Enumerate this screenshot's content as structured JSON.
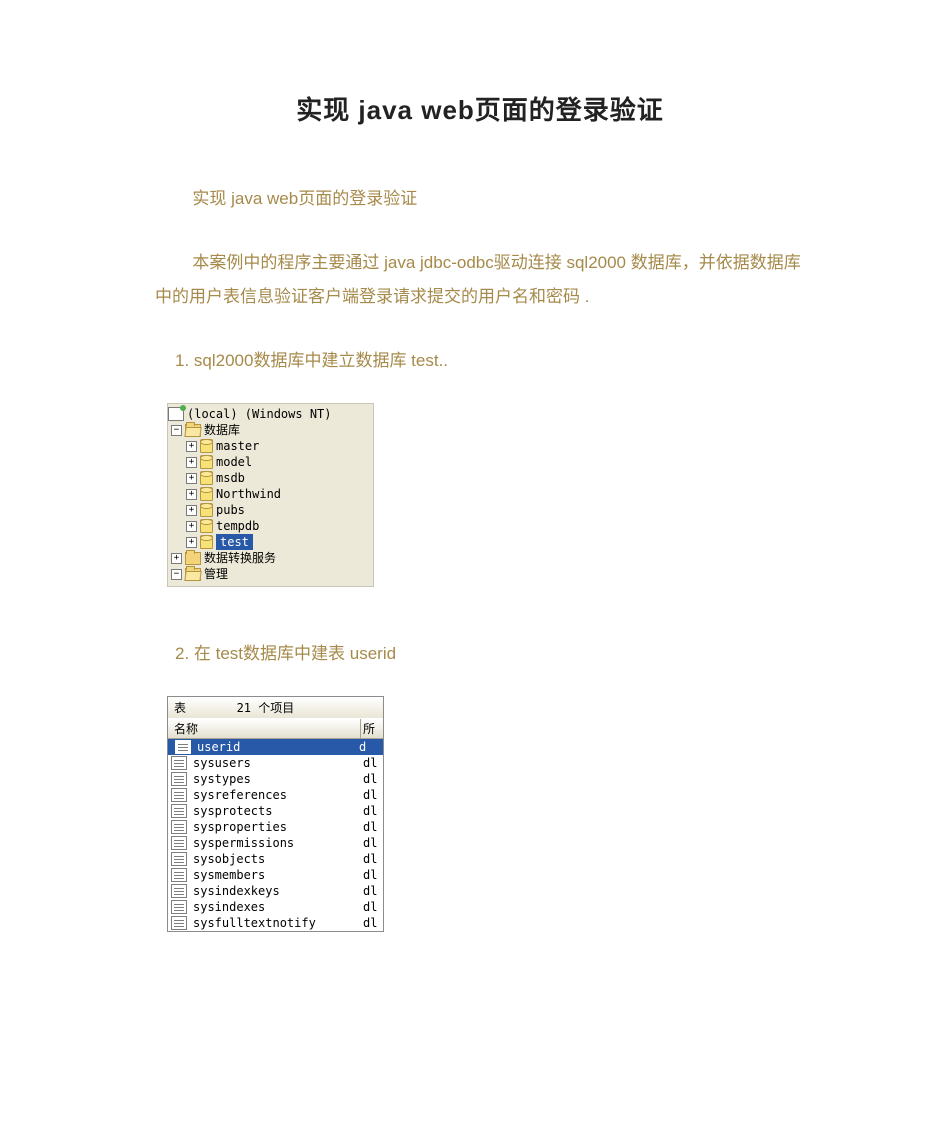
{
  "title": "实现 java  web页面的登录验证",
  "subtitle": "实现 java web页面的登录验证",
  "intro": "本案例中的程序主要通过 java jdbc-odbc驱动连接 sql2000 数据库，并依据数据库中的用户表信息验证客户端登录请求提交的用户名和密码 .",
  "step1": "1. sql2000数据库中建立数据库 test..",
  "step2": "2. 在 test数据库中建表 userid",
  "tree": {
    "server": "(local) (Windows NT)",
    "root_folder": "数据库",
    "dbs": [
      "master",
      "model",
      "msdb",
      "Northwind",
      "pubs",
      "tempdb",
      "test"
    ],
    "selected": "test",
    "other_nodes": [
      "数据转换服务",
      "管理"
    ]
  },
  "table_list": {
    "header": "表       21 个项目",
    "col1": "名称",
    "col2": "所",
    "selected": "userid",
    "items": [
      {
        "name": "userid",
        "c2": "d"
      },
      {
        "name": "sysusers",
        "c2": "dl"
      },
      {
        "name": "systypes",
        "c2": "dl"
      },
      {
        "name": "sysreferences",
        "c2": "dl"
      },
      {
        "name": "sysprotects",
        "c2": "dl"
      },
      {
        "name": "sysproperties",
        "c2": "dl"
      },
      {
        "name": "syspermissions",
        "c2": "dl"
      },
      {
        "name": "sysobjects",
        "c2": "dl"
      },
      {
        "name": "sysmembers",
        "c2": "dl"
      },
      {
        "name": "sysindexkeys",
        "c2": "dl"
      },
      {
        "name": "sysindexes",
        "c2": "dl"
      },
      {
        "name": "sysfulltextnotify",
        "c2": "dl"
      }
    ]
  }
}
